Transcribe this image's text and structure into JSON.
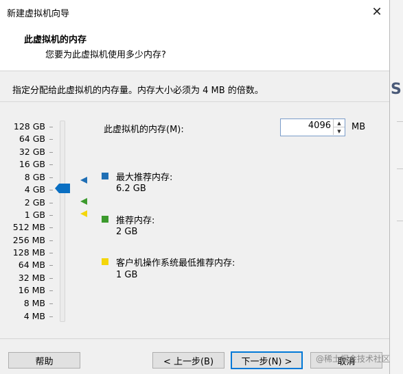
{
  "window": {
    "title": "新建虚拟机向导"
  },
  "header": {
    "title": "此虚拟机的内存",
    "subtitle": "您要为此虚拟机使用多少内存?"
  },
  "instruction": "指定分配给此虚拟机的内存量。内存大小必须为 4 MB 的倍数。",
  "memory_scale": [
    "128 GB",
    "64 GB",
    "32 GB",
    "16 GB",
    "8 GB",
    "4 GB",
    "2 GB",
    "1 GB",
    "512 MB",
    "256 MB",
    "128 MB",
    "64 MB",
    "32 MB",
    "16 MB",
    "8 MB",
    "4 MB"
  ],
  "memory": {
    "label": "此虚拟机的内存(M):",
    "value": "4096",
    "unit": "MB",
    "selected_scale": "4 GB"
  },
  "recommendations": [
    {
      "label": "最大推荐内存:",
      "value": "6.2 GB",
      "color": "#1f6fb5"
    },
    {
      "label": "推荐内存:",
      "value": "2 GB",
      "color": "#3c9a2d"
    },
    {
      "label": "客户机操作系统最低推荐内存:",
      "value": "1 GB",
      "color": "#f4d60a"
    }
  ],
  "buttons": {
    "help": "帮助",
    "back": "< 上一步(B)",
    "next": "下一步(N) >",
    "cancel": "取消"
  },
  "watermark": "@稀土掘金技术社区",
  "icons": {
    "close": "close-icon",
    "spin_up": "arrow-up-icon",
    "spin_down": "arrow-down-icon"
  }
}
